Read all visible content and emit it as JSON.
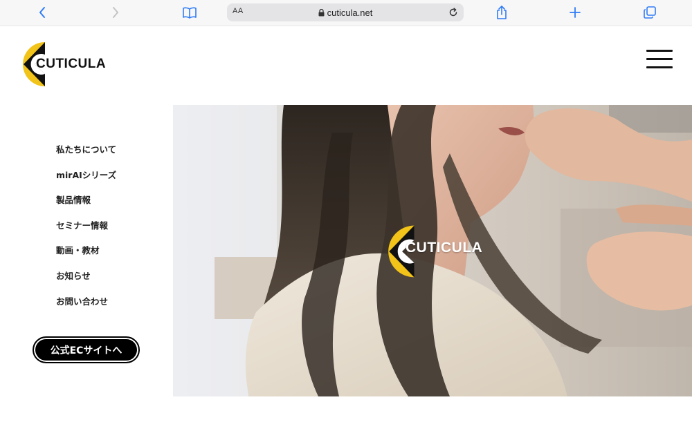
{
  "browser": {
    "address_aa": "AA",
    "url": "cuticula.net"
  },
  "site": {
    "logo_text": "CUTICULA",
    "hero_logo_text": "CUTICULA",
    "brand_colors": {
      "yellow": "#f2c318",
      "black": "#111111"
    }
  },
  "nav": {
    "items": [
      {
        "label": "私たちについて"
      },
      {
        "label": "mirAIシリーズ"
      },
      {
        "label": "製品情報"
      },
      {
        "label": "セミナー情報"
      },
      {
        "label": "動画・教材"
      },
      {
        "label": "お知らせ"
      },
      {
        "label": "お問い合わせ"
      }
    ],
    "ec_button_label": "公式ECサイトへ"
  },
  "icons": [
    "chevron-left-icon",
    "chevron-right-icon",
    "book-icon",
    "lock-icon",
    "reload-icon",
    "share-icon",
    "plus-icon",
    "tabs-icon",
    "menu-icon"
  ]
}
